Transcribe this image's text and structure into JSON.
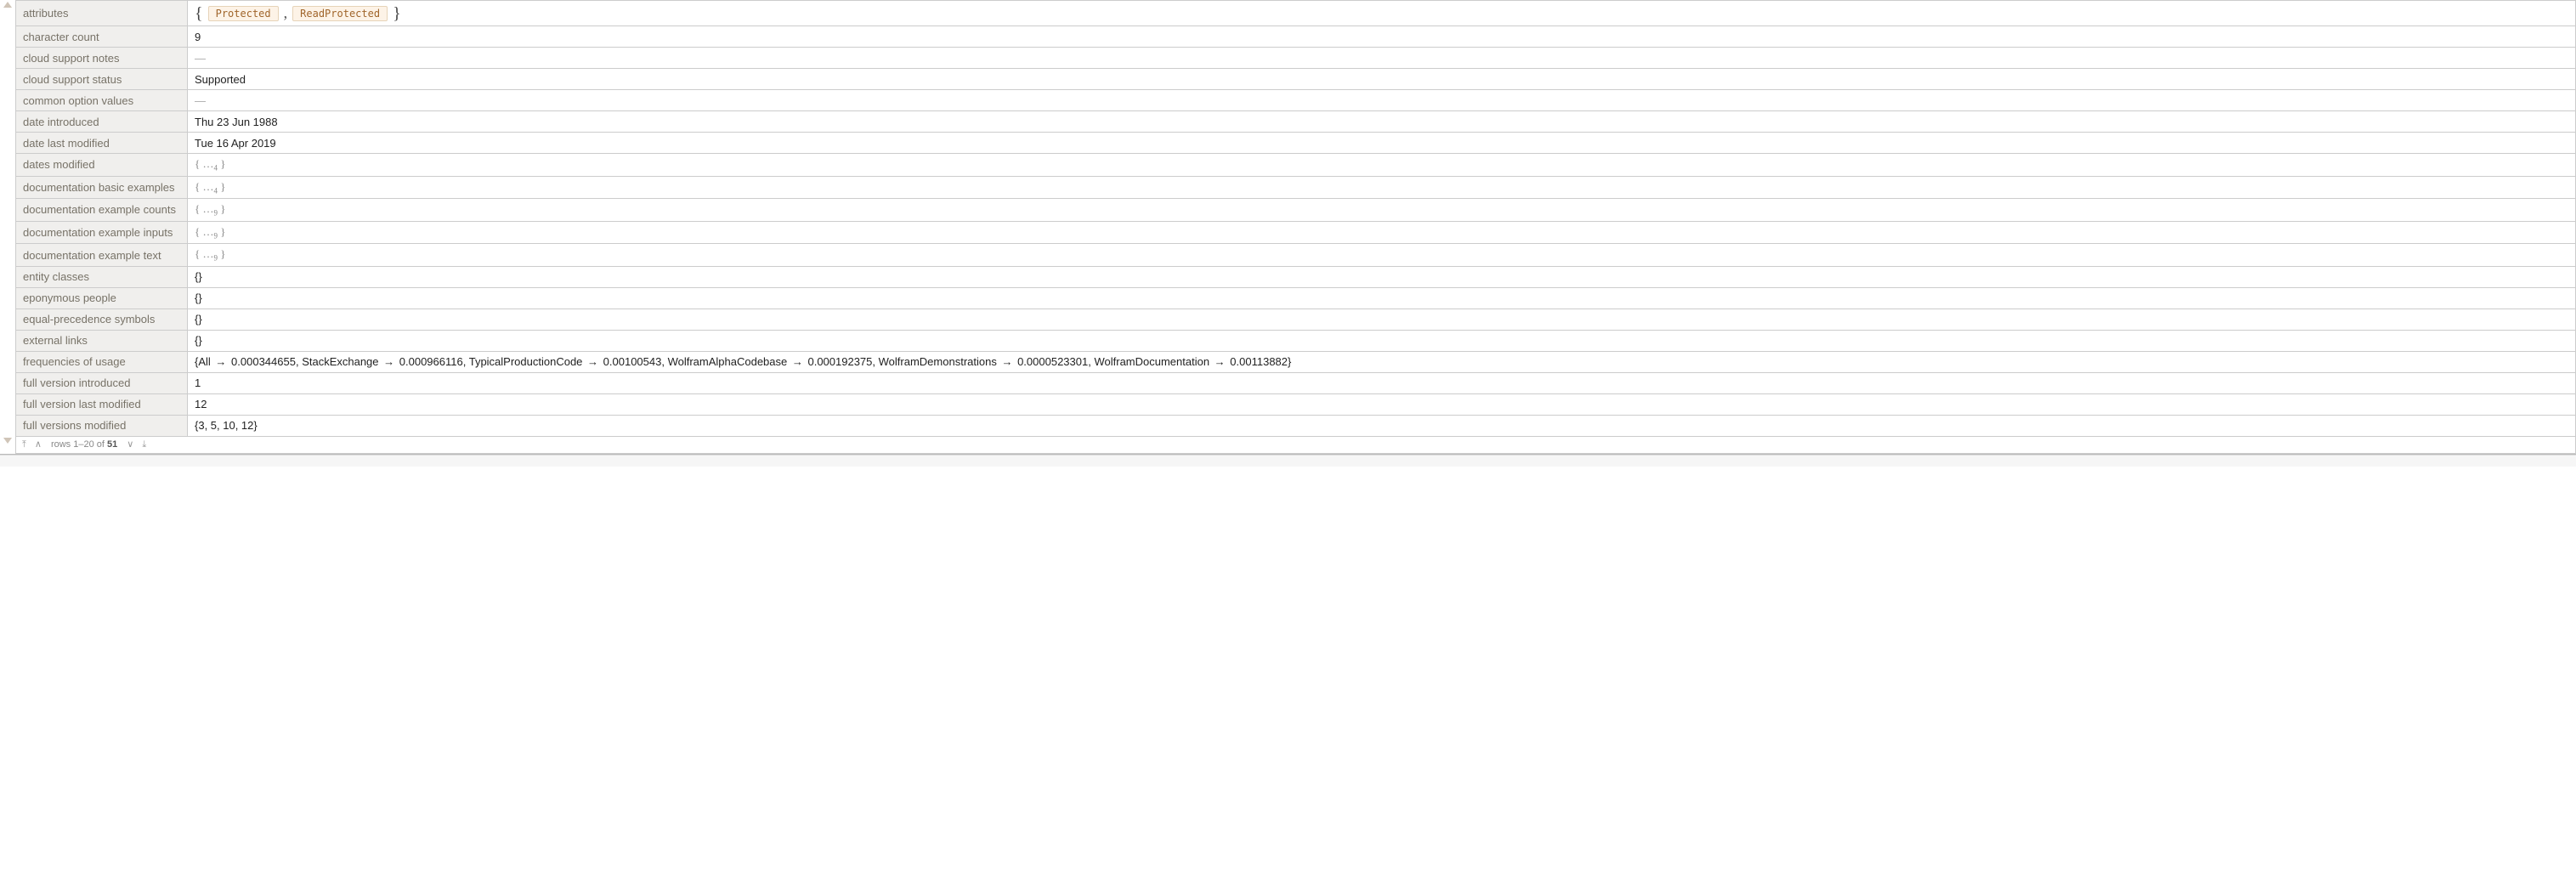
{
  "gutter": {
    "top_glyph": "△",
    "bottom_glyph": "▽"
  },
  "rows": [
    {
      "key": "attributes",
      "type": "tags",
      "brace_open": "{",
      "brace_close": "}",
      "tags": [
        "Protected",
        "ReadProtected"
      ],
      "sep": ","
    },
    {
      "key": "character count",
      "type": "text",
      "value": "9"
    },
    {
      "key": "cloud support notes",
      "type": "dash",
      "value": "—"
    },
    {
      "key": "cloud support status",
      "type": "text",
      "value": "Supported"
    },
    {
      "key": "common option values",
      "type": "dash",
      "value": "—"
    },
    {
      "key": "date introduced",
      "type": "text",
      "value": "Thu 23 Jun 1988"
    },
    {
      "key": "date last modified",
      "type": "text",
      "value": "Tue 16 Apr 2019"
    },
    {
      "key": "dates modified",
      "type": "elided",
      "open": "{",
      "ell": "…",
      "count": "4",
      "close": "}"
    },
    {
      "key": "documentation basic examples",
      "type": "elided",
      "open": "{",
      "ell": "…",
      "count": "4",
      "close": "}"
    },
    {
      "key": "documentation example counts",
      "type": "elided",
      "open": "{",
      "ell": "…",
      "count": "9",
      "close": "}"
    },
    {
      "key": "documentation example inputs",
      "type": "elided",
      "open": "{",
      "ell": "…",
      "count": "9",
      "close": "}"
    },
    {
      "key": "documentation example text",
      "type": "elided",
      "open": "{",
      "ell": "…",
      "count": "9",
      "close": "}"
    },
    {
      "key": "entity classes",
      "type": "text",
      "value": "{}"
    },
    {
      "key": "eponymous people",
      "type": "text",
      "value": "{}"
    },
    {
      "key": "equal-precedence symbols",
      "type": "text",
      "value": "{}"
    },
    {
      "key": "external links",
      "type": "text",
      "value": "{}"
    },
    {
      "key": "frequencies of usage",
      "type": "assoc",
      "open": "{",
      "close": "}",
      "arrow": "→",
      "pairs": [
        {
          "k": "All",
          "v": "0.000344655"
        },
        {
          "k": "StackExchange",
          "v": "0.000966116"
        },
        {
          "k": "TypicalProductionCode",
          "v": "0.00100543"
        },
        {
          "k": "WolframAlphaCodebase",
          "v": "0.000192375"
        },
        {
          "k": "WolframDemonstrations",
          "v": "0.0000523301"
        },
        {
          "k": "WolframDocumentation",
          "v": "0.00113882"
        }
      ]
    },
    {
      "key": "full version introduced",
      "type": "text",
      "value": "1"
    },
    {
      "key": "full version last modified",
      "type": "text",
      "value": "12"
    },
    {
      "key": "full versions modified",
      "type": "text",
      "value": "{3, 5, 10, 12}"
    }
  ],
  "footer": {
    "first_icon": "⤒",
    "prev_icon": "∧",
    "label_prefix": "rows ",
    "range": "1–20",
    "of_word": " of ",
    "total": "51",
    "next_icon": "∨",
    "last_icon": "⤓"
  }
}
